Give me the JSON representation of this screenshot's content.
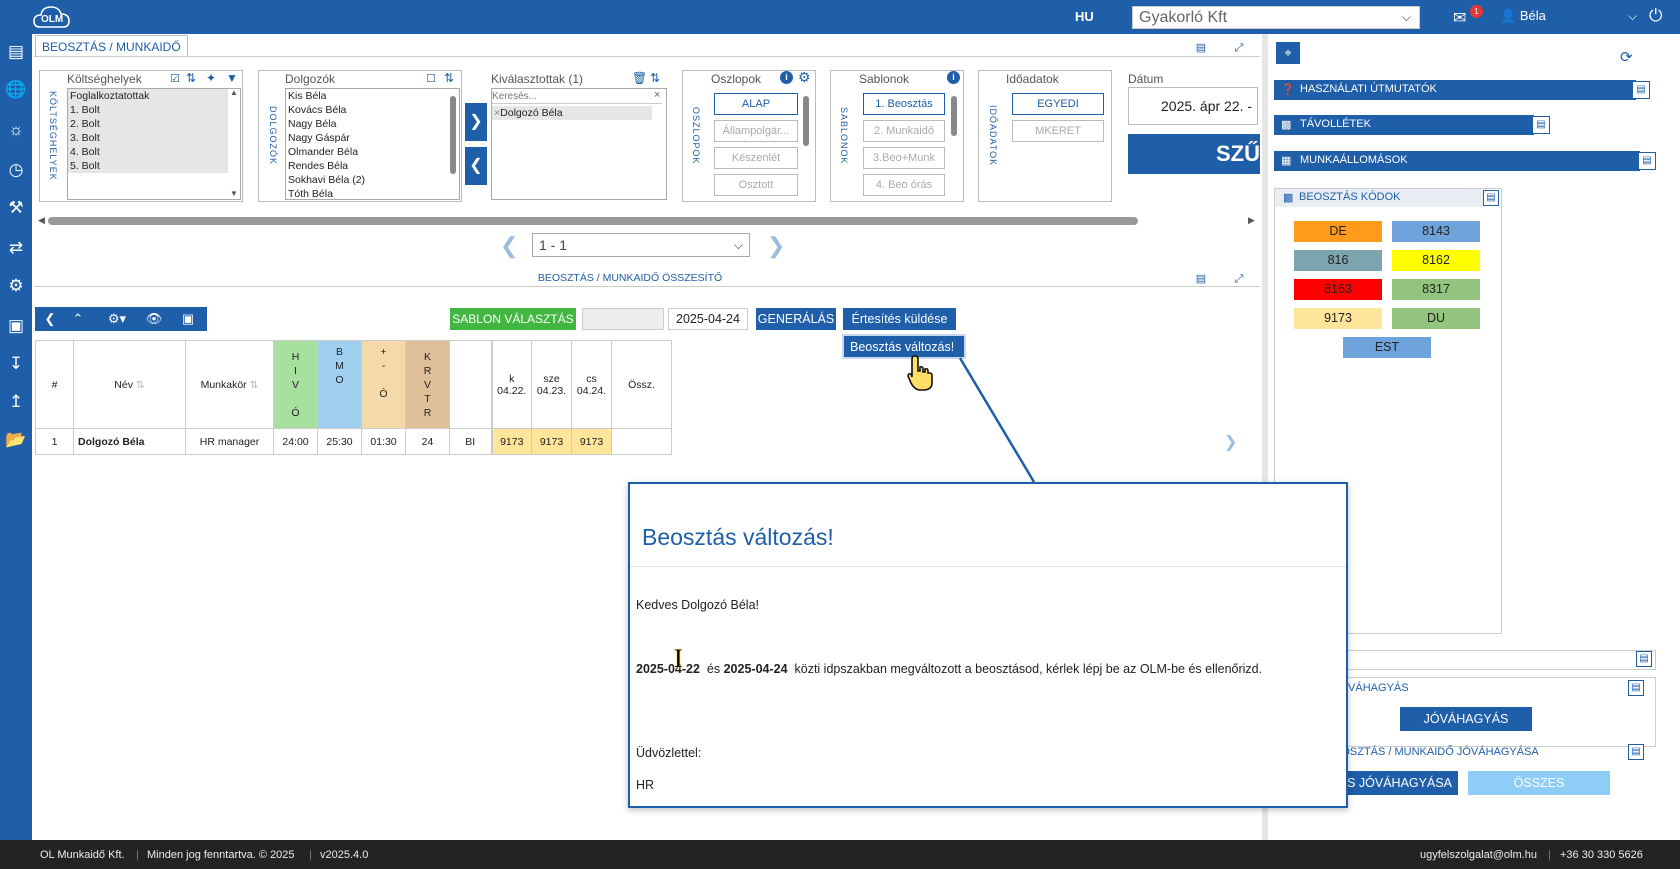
{
  "header": {
    "logo": "OLM",
    "lang": "HU",
    "company": "Gyakorló Kft",
    "mail_badge": "1",
    "user": "Béla"
  },
  "main": {
    "tab": "BEOSZTÁS / MUNKAIDŐ",
    "filters": {
      "koltseg": {
        "vlabel": "KÖLTSÉGHELYEK",
        "title": "Költséghelyek",
        "items": [
          "Foglalkoztatottak",
          "1. Bolt",
          "2. Bolt",
          "3. Bolt",
          "4. Bolt",
          "5. Bolt"
        ]
      },
      "dolgozok": {
        "vlabel": "DOLGOZÓK",
        "title": "Dolgozók",
        "items": [
          "Kis Béla",
          "Kovács Béla",
          "Nagy Béla",
          "Nagy Gáspár",
          "Olmander Béla",
          "Rendes Béla",
          "Sokhavi Béla (2)",
          "Tóth Béla"
        ]
      },
      "kivalasztott": {
        "title": "Kiválasztottak (1)",
        "search_placeholder": "Keresés...",
        "items": [
          "Dolgozó Béla"
        ]
      },
      "oszlopok": {
        "vlabel": "OSZLOPOK",
        "title": "Oszlopok",
        "buttons": [
          "ALAP",
          "Állampolgár...",
          "Készenlét",
          "Osztott"
        ]
      },
      "sablonok": {
        "vlabel": "SABLONOK",
        "title": "Sablonok",
        "buttons": [
          "1. Beosztás",
          "2. Munkaidő",
          "3.Beo+Munk",
          "4. Beo órás"
        ]
      },
      "idoadatok": {
        "vlabel": "IDŐADATOK",
        "title": "Időadatok",
        "buttons": [
          "EGYEDI",
          "MKERET"
        ]
      },
      "datum": {
        "title": "Dátum",
        "value": "2025. ápr 22.  -",
        "button": "SZŰR"
      }
    },
    "pager": "1 - 1",
    "section_title": "BEOSZTÁS / MUNKAIDŐ ÖSSZESÍTŐ",
    "actions": {
      "sablon": "SABLON VÁLASZTÁS",
      "date": "2025-04-24",
      "generalas": "GENERÁLÁS",
      "ertesites": "Értesítés küldése",
      "menu_item": "Beosztás változás!"
    },
    "table": {
      "headers": {
        "num": "#",
        "name": "Név",
        "job": "Munkakör",
        "hivo": [
          "H",
          "I",
          "V",
          "Ó"
        ],
        "bmo": [
          "B",
          "M",
          "O"
        ],
        "plus": [
          "+",
          "-",
          "Ó"
        ],
        "krvtr": [
          "K",
          "R",
          "V",
          "T",
          "R"
        ],
        "days": [
          {
            "d": "k",
            "date": "04.22."
          },
          {
            "d": "sze",
            "date": "04.23."
          },
          {
            "d": "cs",
            "date": "04.24."
          }
        ],
        "sum": "Össz."
      },
      "row": {
        "num": "1",
        "name": "Dolgozó Béla",
        "job": "HR manager",
        "hivo": "24:00",
        "bmo": "25:30",
        "plus": "01:30",
        "krvtr": "24",
        "bi": "BI",
        "days": [
          "9173",
          "9173",
          "9173"
        ]
      }
    }
  },
  "right": {
    "guides": "HASZNÁLATI ÚTMUTATÓK",
    "absences": "TÁVOLLÉTEK",
    "workstations": "MUNKAÁLLOMÁSOK",
    "codes_title": "BEOSZTÁS KÓDOK",
    "codes": [
      {
        "code": "DE",
        "color": "#ff9a1a"
      },
      {
        "code": "8143",
        "color": "#6fa3dc"
      },
      {
        "code": "816",
        "color": "#7ba4ae"
      },
      {
        "code": "8162",
        "color": "#ffff00"
      },
      {
        "code": "8163",
        "color": "#ff0000"
      },
      {
        "code": "8317",
        "color": "#93c47d"
      },
      {
        "code": "9173",
        "color": "#ffe599"
      },
      {
        "code": "DU",
        "color": "#93c47d"
      },
      {
        "code": "EST",
        "color": "#6fa3dc"
      }
    ],
    "jovahagyas_label": "JÓVÁHAGYÁS",
    "jovahagyas_btn": "JÓVÁHAGYÁS",
    "beo_jov_label": "BOSZTÁS / MUNKAIDŐ JÓVÁHAGYÁSA",
    "all_approve": "ZES JÓVÁHAGYÁSA",
    "all_revoke": "ÖSSZES VISSZAVONÁSA"
  },
  "modal": {
    "title": "Beosztás változás!",
    "greeting": "Kedves Dolgozó Béla!",
    "date_from": "2025-04-22",
    "and": "és",
    "date_to": "2025-04-24",
    "body_rest": "közti idpszakban megváltozott a beosztásod, kérlek lépj be az OLM-be és ellenőrizd.",
    "closing": "Üdvözlettel:",
    "signature": "HR"
  },
  "footer": {
    "company": "OL Munkaidő Kft.",
    "rights": "Minden jog fenntartva. © 2025",
    "version": "v2025.4.0",
    "email": "ugyfelszolgalat@olm.hu",
    "phone": "+36 30 330 5626"
  },
  "colors": {
    "brand": "#1f5ea8",
    "green": "#41b641",
    "hivo": "#a8e0a0",
    "bmo": "#9fd0f0",
    "plus": "#f5d9a8",
    "krvtr": "#e0c09a",
    "day": "#ffe599"
  }
}
